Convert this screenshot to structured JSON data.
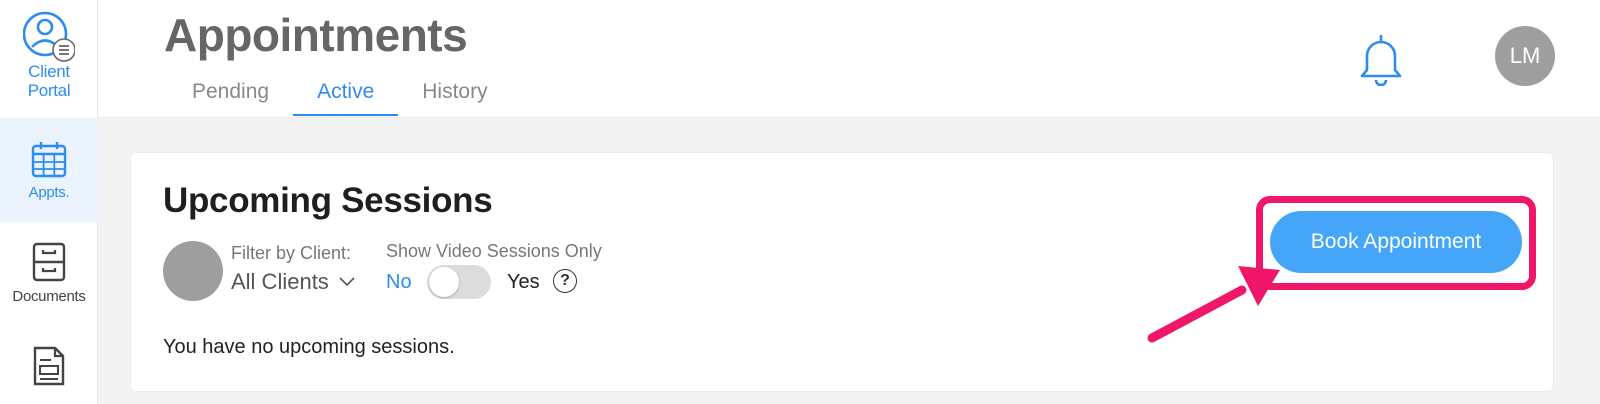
{
  "app": {
    "logo_line1": "Client",
    "logo_line2": "Portal",
    "user_initials": "LM"
  },
  "sidebar": {
    "items": [
      {
        "label": "Appts.",
        "icon": "calendar-icon",
        "active": true
      },
      {
        "label": "Documents",
        "icon": "file-cabinet-icon",
        "active": false
      },
      {
        "label": "",
        "icon": "document-icon",
        "active": false
      }
    ]
  },
  "header": {
    "title": "Appointments",
    "tabs": [
      {
        "label": "Pending"
      },
      {
        "label": "Active",
        "active": true
      },
      {
        "label": "History"
      }
    ]
  },
  "card": {
    "title": "Upcoming Sessions",
    "filter_label": "Filter by Client:",
    "filter_value": "All Clients",
    "video_label": "Show Video Sessions Only",
    "toggle_no": "No",
    "toggle_yes": "Yes",
    "toggle_on": false,
    "help_glyph": "?",
    "empty_message": "You have no upcoming sessions.",
    "book_button": "Book Appointment"
  },
  "colors": {
    "accent": "#2d8cf0",
    "button": "#45a5f8",
    "highlight": "#f0166a",
    "avatar": "#9e9e9e"
  }
}
